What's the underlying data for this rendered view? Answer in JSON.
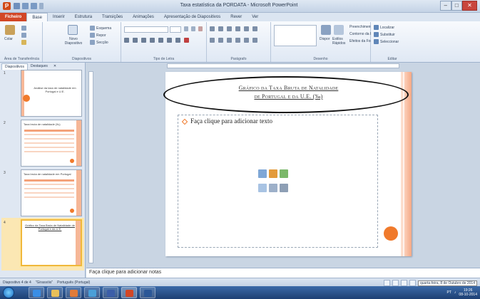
{
  "window": {
    "title": "Taxa estatística da PORDATA - Microsoft PowerPoint",
    "controls": [
      "–",
      "□",
      "✕"
    ]
  },
  "tabs": [
    {
      "label": "Ficheiro"
    },
    {
      "label": "Base"
    },
    {
      "label": "Inserir"
    },
    {
      "label": "Estrutura"
    },
    {
      "label": "Transições"
    },
    {
      "label": "Animações"
    },
    {
      "label": "Apresentação de Diapositivos"
    },
    {
      "label": "Rever"
    },
    {
      "label": "Ver"
    }
  ],
  "ribbon": {
    "groups": {
      "clipboard": "Área de Transferência",
      "slides": "Diapositivos",
      "font": "Tipo de Letra",
      "paragraph": "Parágrafo",
      "drawing": "Desenho",
      "editing": "Editar"
    },
    "paste_label": "Colar",
    "new_slide_label": "Novo Diapositivo",
    "layout_label": "Esquema",
    "reset_label": "Repor",
    "section_label": "Secção",
    "arrange_label": "Dispor",
    "quick_styles_label": "Estilos Rápidos",
    "shape_fill_label": "Preenchimento da Forma",
    "shape_outline_label": "Contorno da Forma",
    "shape_effects_label": "Efeitos da Forma",
    "find_label": "Localizar",
    "replace_label": "Substituir",
    "select_label": "Seleccionar"
  },
  "left_panel": {
    "tabs": [
      "Diapositivos",
      "Destaques"
    ],
    "slides": [
      {
        "num": "1",
        "title": "Análise da taxa de natalidade em Portugal e U.E."
      },
      {
        "num": "2",
        "title": "Taxa bruta de natalidade (‰)"
      },
      {
        "num": "3",
        "title": "Taxa bruta de natalidade em Portugal"
      },
      {
        "num": "4",
        "title": "Gráfico da Taxa Bruta de Natalidade de Portugal e da U.E."
      }
    ]
  },
  "slide": {
    "title_line1": "Gráfico da Taxa Bruta de Natalidade",
    "title_line2": "de Portugal e da U.E. (‰)",
    "content_placeholder": "Faça clique para adicionar texto"
  },
  "notes": {
    "placeholder": "Faça clique para adicionar notas"
  },
  "status": {
    "slide_info": "Diapositivo 4 de 4",
    "theme": "\"Girassóis\"",
    "language": "Português (Portugal)",
    "zoom": "—",
    "date_text": "quarta-feira, 8 de Outubro de 2014"
  },
  "taskbar": {
    "time": "19:26",
    "date": "08-10-2014",
    "lang": "PT"
  },
  "colors": {
    "accent": "#f07a2c",
    "file_tab": "#d24726",
    "slide_strip": "#f6a985"
  }
}
